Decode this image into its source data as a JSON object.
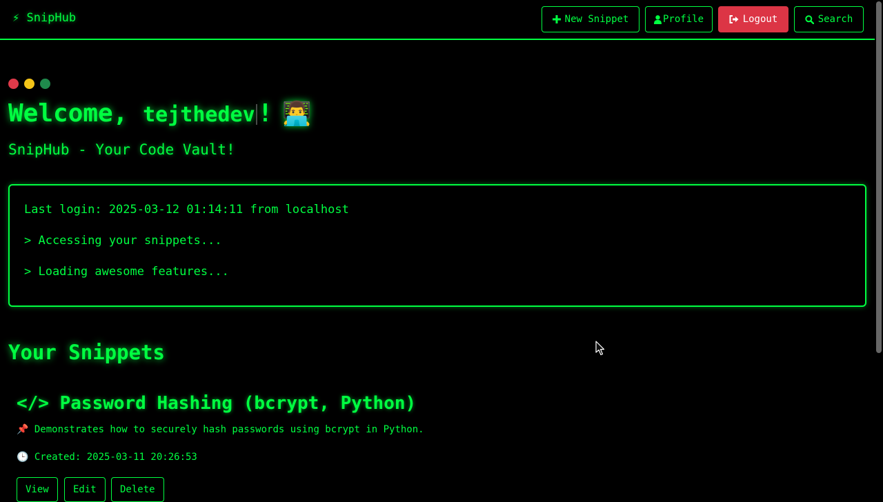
{
  "navbar": {
    "brand": "⚡ SnipHub",
    "buttons": {
      "new_snippet": "New Snippet",
      "profile": "Profile",
      "logout": "Logout",
      "search": "Search"
    }
  },
  "hero": {
    "welcome_prefix": "Welcome, ",
    "username": "tejthedev",
    "welcome_suffix": "!",
    "emoji": "👨‍💻",
    "tagline": "SnipHub - Your Code Vault!"
  },
  "terminal": {
    "lines": [
      "Last login: 2025-03-12 01:14:11 from localhost",
      "> Accessing your snippets...",
      "> Loading awesome features..."
    ]
  },
  "snippets": {
    "heading": "Your Snippets",
    "items": [
      {
        "title": "</> Password Hashing (bcrypt, Python)",
        "description": "📌 Demonstrates how to securely hash passwords using bcrypt in Python.",
        "created": "🕒 Created: 2025-03-11 20:26:53",
        "actions": {
          "view": "View",
          "edit": "Edit",
          "delete": "Delete"
        }
      }
    ]
  },
  "colors": {
    "accent": "#00ff41",
    "background": "#000000",
    "logout_bg": "#dc3545",
    "dot_red": "#e03a4a",
    "dot_yellow": "#f5c518",
    "dot_green": "#1f8a4c"
  },
  "icons": {
    "new_snippet": "plus-icon",
    "profile": "user-icon",
    "logout": "sign-out-icon",
    "search": "search-icon"
  }
}
